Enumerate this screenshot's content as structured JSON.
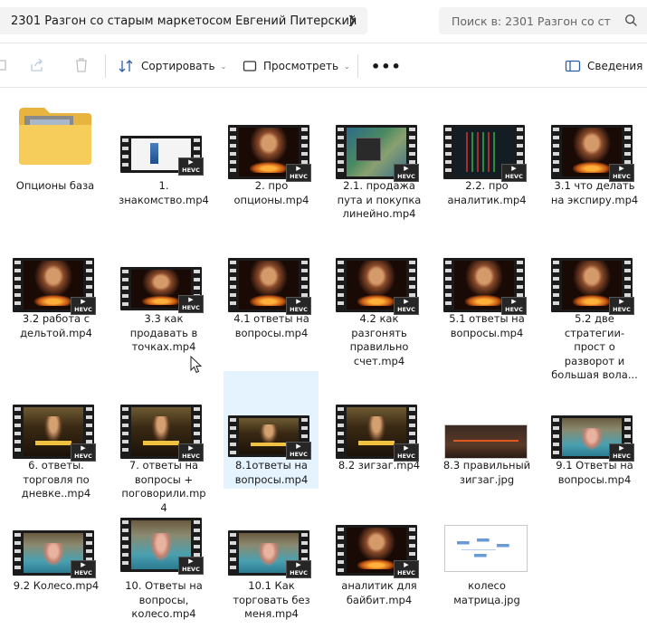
{
  "address": {
    "path": "2301 Разгон со старым маркетосом Евгений Питерский"
  },
  "search": {
    "placeholder": "Поиск в: 2301 Разгон со ст"
  },
  "toolbar": {
    "sort_label": "Сортировать",
    "view_label": "Просмотреть",
    "more_label": "•••",
    "details_label": "Сведения"
  },
  "files": [
    {
      "name": "Опционы база",
      "kind": "folder"
    },
    {
      "name": "1. знакомство.mp4",
      "kind": "video"
    },
    {
      "name": "2. про опционы.mp4",
      "kind": "video"
    },
    {
      "name": "2.1. продажа пута и покупка линейно.mp4",
      "kind": "video"
    },
    {
      "name": "2.2. про аналитик.mp4",
      "kind": "video"
    },
    {
      "name": "3.1 что делать на экспиру.mp4",
      "kind": "video"
    },
    {
      "name": "3.2 работа с дельтой.mp4",
      "kind": "video"
    },
    {
      "name": "3.3 как продавать в точках.mp4",
      "kind": "video"
    },
    {
      "name": "4.1 ответы на вопросы.mp4",
      "kind": "video"
    },
    {
      "name": "4.2 как разгонять правильно счет.mp4",
      "kind": "video"
    },
    {
      "name": "5.1 ответы на вопросы.mp4",
      "kind": "video"
    },
    {
      "name": "5.2 две стратегии-прост о разворот и большая вола...",
      "kind": "video"
    },
    {
      "name": "6. ответы. торговля по дневке..mp4",
      "kind": "video"
    },
    {
      "name": "7. ответы на вопросы + поговорили.mp 4",
      "kind": "video"
    },
    {
      "name": "8.1ответы на вопросы.mp4",
      "kind": "video"
    },
    {
      "name": "8.2 зигзаг.mp4",
      "kind": "video"
    },
    {
      "name": "8.3 правильный зигзаг.jpg",
      "kind": "image"
    },
    {
      "name": "9.1 Ответы на вопросы.mp4",
      "kind": "video"
    },
    {
      "name": "9.2 Колесо.mp4",
      "kind": "video"
    },
    {
      "name": "10. Ответы на вопросы, колесо.mp4",
      "kind": "video"
    },
    {
      "name": "10.1 Как торговать без меня.mp4",
      "kind": "video"
    },
    {
      "name": "аналитик для байбит.mp4",
      "kind": "video"
    },
    {
      "name": "колесо матрица.jpg",
      "kind": "image"
    }
  ],
  "badge": "HEVC"
}
